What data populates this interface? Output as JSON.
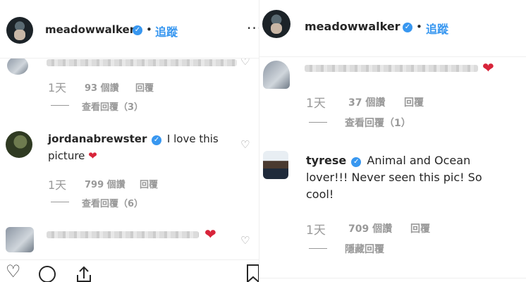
{
  "post": {
    "username": "meadowwalker",
    "separator": "•",
    "follow_label": "追蹤",
    "more_label": "···"
  },
  "left": {
    "top_comment": {
      "time": "1天",
      "likes": "93 個讚",
      "reply": "回覆",
      "view_replies": "查看回覆（3）"
    },
    "comment": {
      "username": "jordanabrewster",
      "text": "I love this picture",
      "emoji": "❤",
      "time": "1天",
      "likes": "799 個讚",
      "reply": "回覆",
      "view_replies": "查看回覆（6）"
    },
    "bottom_emoji": "❤"
  },
  "right": {
    "first_comment": {
      "emoji": "❤",
      "time": "1天",
      "likes": "37 個讚",
      "reply": "回覆",
      "view_replies": "查看回覆（1）"
    },
    "comment": {
      "username": "tyrese",
      "text_line1": "Animal and Ocean",
      "text_line2": "lover!!! Never seen this pic! So",
      "text_line3": "cool!",
      "time": "1天",
      "likes": "709 個讚",
      "reply": "回覆",
      "hide_replies": "隱藏回覆"
    }
  },
  "icons": {
    "verified": "verified-badge-icon",
    "heart": "heart-icon",
    "comment": "comment-icon",
    "share": "share-icon",
    "bookmark": "bookmark-icon"
  },
  "colors": {
    "link_blue": "#3897f0",
    "heart_red": "#d8243a",
    "muted": "#999999"
  }
}
